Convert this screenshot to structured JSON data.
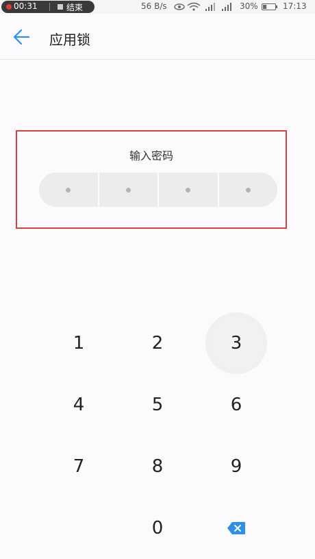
{
  "status_bar": {
    "recording_time": "00:31",
    "recording_end_label": "结束",
    "network_speed": "56 B/s",
    "battery_percent": "30%",
    "clock": "17:13",
    "icons": [
      "eye-icon",
      "wifi-icon",
      "signal-icon",
      "signal-icon",
      "battery-icon"
    ]
  },
  "app_bar": {
    "back_icon": "arrow-left-icon",
    "title": "应用锁"
  },
  "password": {
    "prompt": "输入密码",
    "length": 4,
    "entered": 0
  },
  "keypad": {
    "keys": [
      "1",
      "2",
      "3",
      "4",
      "5",
      "6",
      "7",
      "8",
      "9",
      "0"
    ],
    "pressed_key": "3",
    "backspace_icon": "backspace-icon"
  },
  "colors": {
    "accent": "#2f8ee6",
    "highlight_border": "#d9403f",
    "recording": "#e53935",
    "background": "#fcfafc"
  }
}
